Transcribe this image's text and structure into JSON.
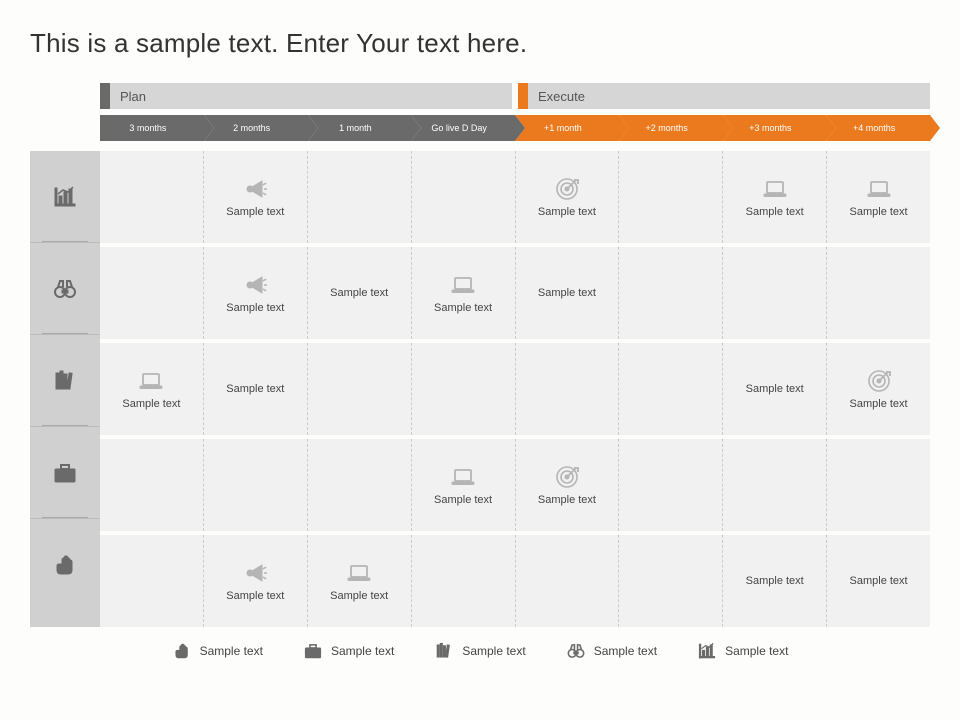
{
  "title": "This is a sample text. Enter Your text here.",
  "phases": {
    "plan": "Plan",
    "execute": "Execute"
  },
  "timeline": [
    "3 months",
    "2 months",
    "1 month",
    "Go live D Day",
    "+1 month",
    "+2 months",
    "+3 months",
    "+4 months"
  ],
  "rows": [
    {
      "icon": "chart-icon",
      "cells": [
        null,
        "megaphone",
        null,
        null,
        "target",
        null,
        "laptop",
        "laptop"
      ]
    },
    {
      "icon": "binoculars-icon",
      "cells": [
        null,
        "megaphone",
        "text",
        "laptop",
        "text",
        null,
        null,
        null
      ]
    },
    {
      "icon": "books-icon",
      "cells": [
        "laptop",
        "text",
        null,
        null,
        null,
        null,
        "text",
        "target"
      ]
    },
    {
      "icon": "briefcase-icon",
      "cells": [
        null,
        null,
        null,
        "laptop",
        "target",
        null,
        null,
        null
      ]
    },
    {
      "icon": "fist-icon",
      "cells": [
        null,
        "megaphone",
        "laptop",
        null,
        null,
        null,
        "text",
        "text"
      ]
    }
  ],
  "cell_label": "Sample text",
  "legend": [
    {
      "icon": "fist-icon",
      "label": "Sample text"
    },
    {
      "icon": "briefcase-icon",
      "label": "Sample text"
    },
    {
      "icon": "books-icon",
      "label": "Sample text"
    },
    {
      "icon": "binoculars-icon",
      "label": "Sample text"
    },
    {
      "icon": "chart-icon",
      "label": "Sample text"
    }
  ],
  "colors": {
    "gray": "#6a6a6a",
    "orange": "#eb7a1e",
    "light": "#f1f1f1",
    "header": "#d6d6d6"
  }
}
